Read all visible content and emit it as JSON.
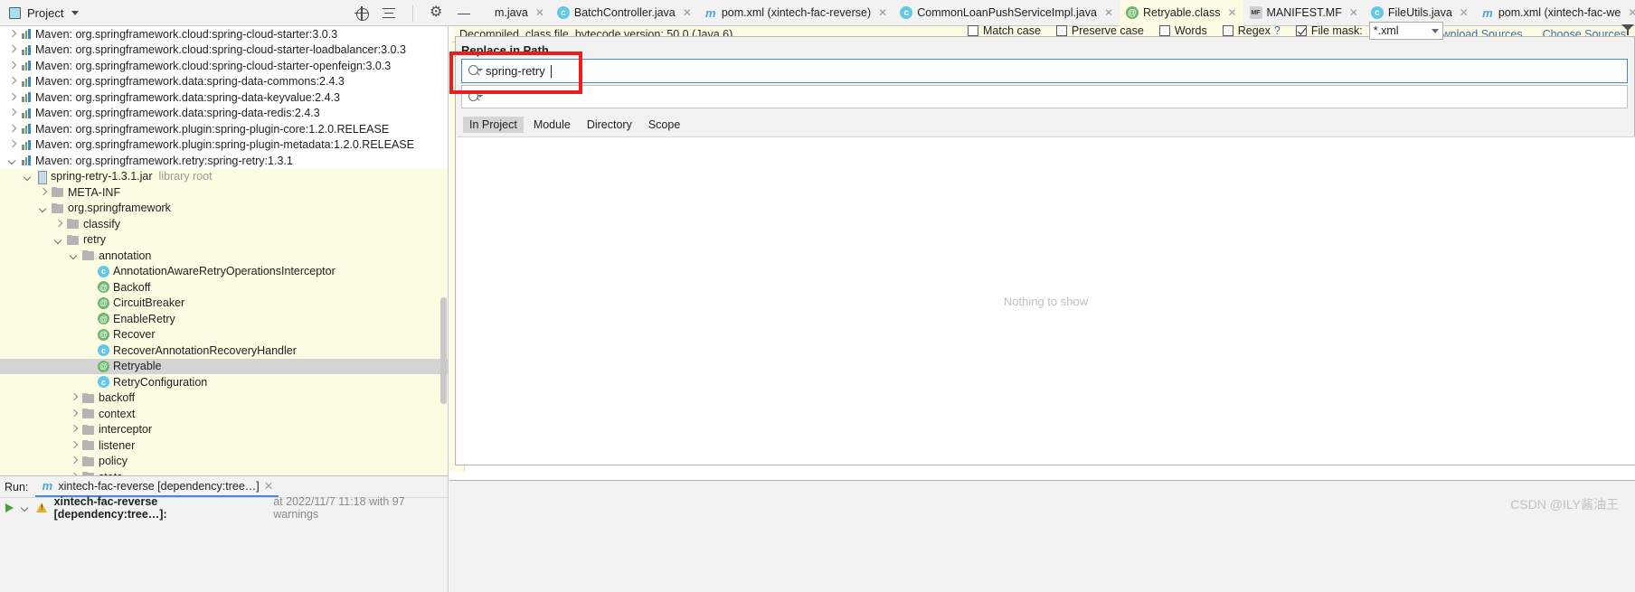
{
  "topbar": {
    "project_label": "Project",
    "icons": [
      "locate-target-icon",
      "collapse-all-icon",
      "settings-gear-icon",
      "hide-icon"
    ]
  },
  "editor_tabs": [
    {
      "label": "m.java",
      "icon": "",
      "active": false,
      "closable": true
    },
    {
      "label": "BatchController.java",
      "icon": "class-icon",
      "active": false,
      "closable": true
    },
    {
      "label": "pom.xml (xintech-fac-reverse)",
      "icon": "maven-icon",
      "active": false,
      "closable": true
    },
    {
      "label": "CommonLoanPushServiceImpl.java",
      "icon": "class-icon",
      "active": false,
      "closable": true
    },
    {
      "label": "Retryable.class",
      "icon": "annotation-icon",
      "active": true,
      "closable": true
    },
    {
      "label": "MANIFEST.MF",
      "icon": "manifest-icon",
      "active": false,
      "closable": true
    },
    {
      "label": "FileUtils.java",
      "icon": "class-icon",
      "active": false,
      "closable": true
    },
    {
      "label": "pom.xml (xintech-fac-we",
      "icon": "maven-icon",
      "active": false,
      "closable": true
    }
  ],
  "tree": [
    {
      "depth": 0,
      "arrow": "right",
      "icon": "maven-icon",
      "label": "Maven: org.springframework.cloud:spring-cloud-starter:3.0.3",
      "selected": false,
      "highlight": false
    },
    {
      "depth": 0,
      "arrow": "right",
      "icon": "maven-icon",
      "label": "Maven: org.springframework.cloud:spring-cloud-starter-loadbalancer:3.0.3",
      "selected": false,
      "highlight": false
    },
    {
      "depth": 0,
      "arrow": "right",
      "icon": "maven-icon",
      "label": "Maven: org.springframework.cloud:spring-cloud-starter-openfeign:3.0.3",
      "selected": false,
      "highlight": false
    },
    {
      "depth": 0,
      "arrow": "right",
      "icon": "maven-icon",
      "label": "Maven: org.springframework.data:spring-data-commons:2.4.3",
      "selected": false,
      "highlight": false
    },
    {
      "depth": 0,
      "arrow": "right",
      "icon": "maven-icon",
      "label": "Maven: org.springframework.data:spring-data-keyvalue:2.4.3",
      "selected": false,
      "highlight": false
    },
    {
      "depth": 0,
      "arrow": "right",
      "icon": "maven-icon",
      "label": "Maven: org.springframework.data:spring-data-redis:2.4.3",
      "selected": false,
      "highlight": false
    },
    {
      "depth": 0,
      "arrow": "right",
      "icon": "maven-icon",
      "label": "Maven: org.springframework.plugin:spring-plugin-core:1.2.0.RELEASE",
      "selected": false,
      "highlight": false
    },
    {
      "depth": 0,
      "arrow": "right",
      "icon": "maven-icon",
      "label": "Maven: org.springframework.plugin:spring-plugin-metadata:1.2.0.RELEASE",
      "selected": false,
      "highlight": false
    },
    {
      "depth": 0,
      "arrow": "down",
      "icon": "maven-icon",
      "label": "Maven: org.springframework.retry:spring-retry:1.3.1",
      "selected": false,
      "highlight": false
    },
    {
      "depth": 1,
      "arrow": "down",
      "icon": "jar-icon",
      "label": "spring-retry-1.3.1.jar",
      "suffix": "library root",
      "selected": false,
      "highlight": true
    },
    {
      "depth": 2,
      "arrow": "right",
      "icon": "folder-icon",
      "label": "META-INF",
      "selected": false,
      "highlight": true
    },
    {
      "depth": 2,
      "arrow": "down",
      "icon": "folder-icon",
      "label": "org.springframework",
      "selected": false,
      "highlight": true
    },
    {
      "depth": 3,
      "arrow": "right",
      "icon": "folder-icon",
      "label": "classify",
      "selected": false,
      "highlight": true
    },
    {
      "depth": 3,
      "arrow": "down",
      "icon": "folder-icon",
      "label": "retry",
      "selected": false,
      "highlight": true
    },
    {
      "depth": 4,
      "arrow": "down",
      "icon": "folder-icon",
      "label": "annotation",
      "selected": false,
      "highlight": true
    },
    {
      "depth": 5,
      "arrow": "none",
      "icon": "class-icon",
      "label": "AnnotationAwareRetryOperationsInterceptor",
      "selected": false,
      "highlight": true
    },
    {
      "depth": 5,
      "arrow": "none",
      "icon": "annotation-icon",
      "label": "Backoff",
      "selected": false,
      "highlight": true
    },
    {
      "depth": 5,
      "arrow": "none",
      "icon": "annotation-icon",
      "label": "CircuitBreaker",
      "selected": false,
      "highlight": true
    },
    {
      "depth": 5,
      "arrow": "none",
      "icon": "annotation-icon",
      "label": "EnableRetry",
      "selected": false,
      "highlight": true
    },
    {
      "depth": 5,
      "arrow": "none",
      "icon": "annotation-icon",
      "label": "Recover",
      "selected": false,
      "highlight": true
    },
    {
      "depth": 5,
      "arrow": "none",
      "icon": "class-icon",
      "label": "RecoverAnnotationRecoveryHandler",
      "selected": false,
      "highlight": true
    },
    {
      "depth": 5,
      "arrow": "none",
      "icon": "annotation-icon",
      "label": "Retryable",
      "selected": true,
      "highlight": true
    },
    {
      "depth": 5,
      "arrow": "none",
      "icon": "class-icon",
      "label": "RetryConfiguration",
      "selected": false,
      "highlight": true
    },
    {
      "depth": 4,
      "arrow": "right",
      "icon": "folder-icon",
      "label": "backoff",
      "selected": false,
      "highlight": true
    },
    {
      "depth": 4,
      "arrow": "right",
      "icon": "folder-icon",
      "label": "context",
      "selected": false,
      "highlight": true
    },
    {
      "depth": 4,
      "arrow": "right",
      "icon": "folder-icon",
      "label": "interceptor",
      "selected": false,
      "highlight": true
    },
    {
      "depth": 4,
      "arrow": "right",
      "icon": "folder-icon",
      "label": "listener",
      "selected": false,
      "highlight": true
    },
    {
      "depth": 4,
      "arrow": "right",
      "icon": "folder-icon",
      "label": "policy",
      "selected": false,
      "highlight": true
    },
    {
      "depth": 4,
      "arrow": "right",
      "icon": "folder-icon",
      "label": "stats",
      "selected": false,
      "highlight": true
    }
  ],
  "editor": {
    "decompiled_banner": "Decompiled .class file, bytecode version: 50.0 (Java 6)",
    "download_sources": "Download Sources",
    "choose_sources": "Choose Sources"
  },
  "dialog": {
    "title": "Replace in Path",
    "search_value": "spring-retry",
    "replace_value": "",
    "options": [
      {
        "label": "Match case",
        "underline": "c",
        "checked": false
      },
      {
        "label": "Preserve case",
        "underline": "e",
        "checked": false
      },
      {
        "label": "Words",
        "underline": "o",
        "checked": false
      },
      {
        "label": "Regex",
        "underline": "x",
        "checked": false,
        "help": "?"
      }
    ],
    "file_mask": {
      "label": "File mask:",
      "checked": true,
      "value": "*.xml"
    },
    "scope_tabs": [
      {
        "label": "In Project",
        "active": true
      },
      {
        "label": "Module",
        "active": false
      },
      {
        "label": "Directory",
        "active": false
      },
      {
        "label": "Scope",
        "active": false
      }
    ],
    "results_empty": "Nothing to show"
  },
  "run_panel": {
    "label": "Run:",
    "tab_label": "xintech-fac-reverse [dependency:tree…]",
    "entry_bold": "xintech-fac-reverse [dependency:tree…]:",
    "entry_meta": "at 2022/11/7 11:18 with 97 warnings"
  },
  "watermark": "CSDN @ILY酱油王",
  "colors": {
    "accent_blue": "#4a88c7",
    "annotation_red": "#ee1c1c",
    "highlight_yellow": "#fcfce3",
    "selection_gray": "#d4d4d4"
  }
}
